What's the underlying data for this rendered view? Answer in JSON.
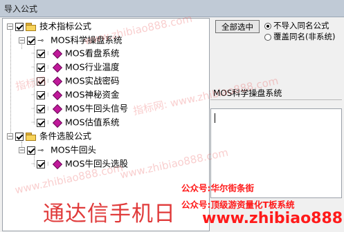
{
  "window": {
    "title": "导入公式"
  },
  "tree": {
    "root1": {
      "label": "技术指标公式",
      "checked": true,
      "expanded": true,
      "icon": "folder-icon"
    },
    "group1": {
      "label": "MOS科学操盘系统",
      "checked": true,
      "expanded": true,
      "icon": "key-icon"
    },
    "group1_items": [
      {
        "label": "MOS看盘系统",
        "checked": true,
        "icon": "formula-gem-icon"
      },
      {
        "label": "MOS行业温度",
        "checked": true,
        "icon": "formula-gem-icon"
      },
      {
        "label": "MOS实战密码",
        "checked": true,
        "icon": "formula-gem-icon"
      },
      {
        "label": "MOS神秘资金",
        "checked": true,
        "icon": "formula-gem-icon"
      },
      {
        "label": "MOS牛回头信号",
        "checked": true,
        "icon": "formula-gem-icon"
      },
      {
        "label": "MOS估值系统",
        "checked": true,
        "icon": "formula-gem-icon"
      }
    ],
    "root2": {
      "label": "条件选股公式",
      "checked": true,
      "expanded": true,
      "icon": "folder-icon"
    },
    "group2": {
      "label": "MOS牛回头",
      "checked": true,
      "expanded": true,
      "icon": "key-icon"
    },
    "group2_items": [
      {
        "label": "MOS牛回头选股",
        "checked": true,
        "icon": "formula-gem-icon"
      }
    ]
  },
  "right": {
    "select_all_button": "全部选中",
    "radio_no_import": "不导入同名公式",
    "radio_overwrite": "覆盖同名(非系统)",
    "selected_option": "不导入同名公式",
    "selected_name": "MOS科学操盘系统",
    "description_text": ""
  },
  "overlay": {
    "watermark_text": "指标网: www.zhibiao888.com",
    "promo_line1": "公众号:华尔街条街",
    "promo_line2": "公众号:顶级游资量化T板系统",
    "brand": "通达信手机日",
    "site": "www.zhibiao888.com"
  },
  "colors": {
    "accent_gem": "#c0199a",
    "folder": "#f7d35a",
    "promo_red": "#ff1a1a"
  }
}
